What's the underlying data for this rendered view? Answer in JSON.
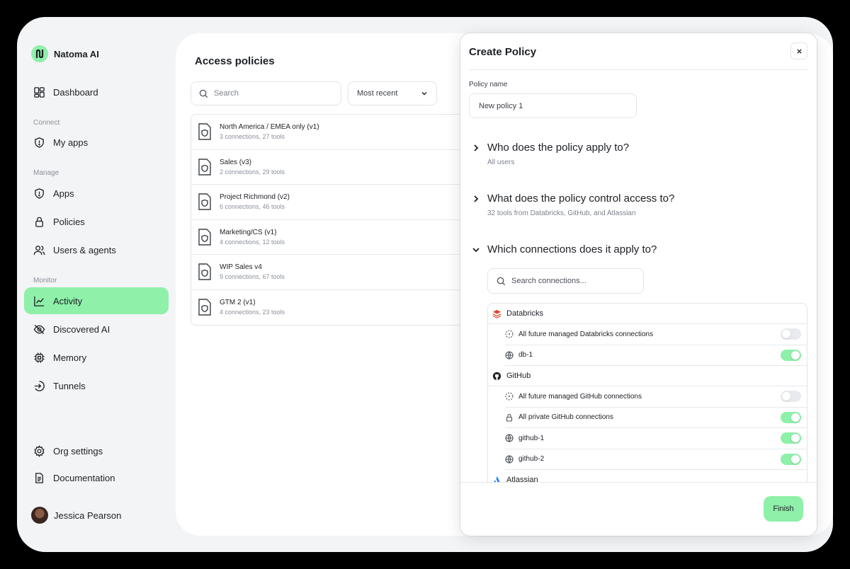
{
  "brand": {
    "name": "Natoma AI"
  },
  "sidebar": {
    "dashboard": "Dashboard",
    "sections": {
      "connect": "Connect",
      "manage": "Manage",
      "monitor": "Monitor"
    },
    "items": {
      "my_apps": "My apps",
      "apps": "Apps",
      "policies": "Policies",
      "users_agents": "Users & agents",
      "activity": "Activity",
      "discovered_ai": "Discovered AI",
      "memory": "Memory",
      "tunnels": "Tunnels",
      "org_settings": "Org settings",
      "documentation": "Documentation"
    },
    "active_item": "activity",
    "user": {
      "name": "Jessica Pearson"
    }
  },
  "main": {
    "title": "Access policies",
    "search": {
      "placeholder": "Search"
    },
    "sort": {
      "selected": "Most recent"
    },
    "policies": [
      {
        "name": "North America / EMEA only (v1)",
        "meta": "3 connections, 27 tools"
      },
      {
        "name": "Sales (v3)",
        "meta": "2 connections, 29 tools"
      },
      {
        "name": "Project Richmond (v2)",
        "meta": "6 connections, 46 tools"
      },
      {
        "name": "Marketing/CS (v1)",
        "meta": "4 connections, 12 tools"
      },
      {
        "name": "WIP Sales v4",
        "meta": "9 connections, 67 tools"
      },
      {
        "name": "GTM 2 (v1)",
        "meta": "4 connections, 23 tools"
      }
    ]
  },
  "modal": {
    "title": "Create Policy",
    "policy_name_label": "Policy name",
    "policy_name_value": "New policy 1",
    "sections": [
      {
        "title": "Who does the policy apply to?",
        "summary": "All users",
        "expanded": false
      },
      {
        "title": "What does the policy control access to?",
        "summary": "32 tools from Databricks, GitHub, and Atlassian",
        "expanded": false
      },
      {
        "title": "Which connections does it apply to?",
        "expanded": true
      }
    ],
    "connection_search": {
      "placeholder": "Search connections..."
    },
    "groups": {
      "databricks": {
        "name": "Databricks",
        "color": "#e8452c",
        "rows": [
          {
            "label": "All future managed Databricks connections",
            "icon": "dashed-circle-icon",
            "enabled": false
          },
          {
            "label": "db-1",
            "icon": "globe-icon",
            "enabled": true
          }
        ]
      },
      "github": {
        "name": "GitHub",
        "rows": [
          {
            "label": "All future managed GitHub connections",
            "icon": "dashed-circle-icon",
            "enabled": false
          },
          {
            "label": "All private GitHub connections",
            "icon": "lock-icon",
            "enabled": true
          },
          {
            "label": "github-1",
            "icon": "globe-icon",
            "enabled": true
          },
          {
            "label": "github-2",
            "icon": "globe-icon",
            "enabled": true
          }
        ]
      },
      "atlassian": {
        "name": "Atlassian",
        "color": "#2684ff"
      }
    },
    "finish_label": "Finish"
  },
  "colors": {
    "accent": "#8ef0a9",
    "border": "#e3e5e8",
    "muted_text": "#8a9099"
  }
}
